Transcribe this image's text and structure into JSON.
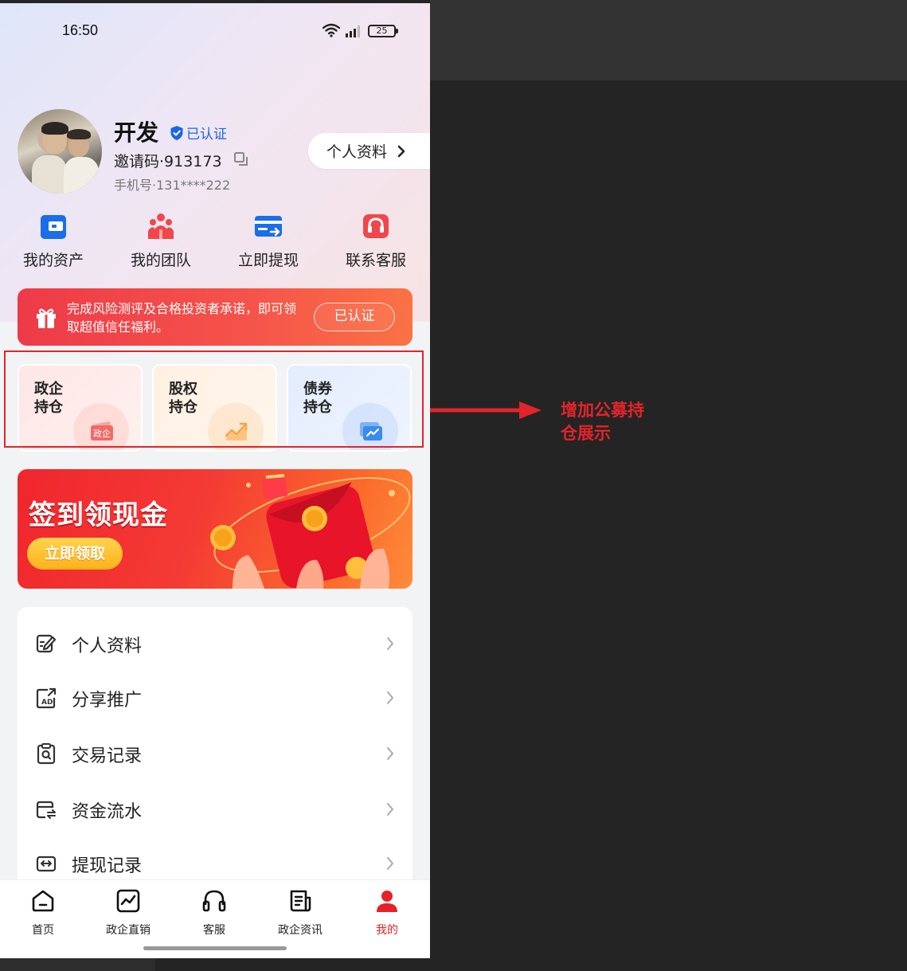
{
  "status_bar": {
    "time": "16:50",
    "battery": "25"
  },
  "profile": {
    "name": "开发",
    "verified_label": "已认证",
    "invite_code": "邀请码·913173",
    "phone": "手机号·131****222",
    "profile_button": "个人资料"
  },
  "quick_actions": [
    {
      "label": "我的资产",
      "icon": "wallet-icon"
    },
    {
      "label": "我的团队",
      "icon": "team-icon"
    },
    {
      "label": "立即提现",
      "icon": "withdraw-card-icon"
    },
    {
      "label": "联系客服",
      "icon": "headset-icon"
    }
  ],
  "risk_banner": {
    "text": "完成风险测评及合格投资者承诺，即可领取超值信任福利。",
    "button": "已认证"
  },
  "holdings": [
    {
      "title": "政企持仓",
      "icon_text": "政企",
      "icon": "gov-holding-icon"
    },
    {
      "title": "股权持仓",
      "icon": "equity-chart-icon"
    },
    {
      "title": "债券持仓",
      "icon": "bond-chart-icon"
    }
  ],
  "signin_banner": {
    "title": "签到领现金",
    "button": "立即领取"
  },
  "menu": [
    {
      "label": "个人资料",
      "icon": "edit-profile-icon"
    },
    {
      "label": "分享推广",
      "icon": "share-ad-icon"
    },
    {
      "label": "交易记录",
      "icon": "transaction-record-icon"
    },
    {
      "label": "资金流水",
      "icon": "fund-flow-icon"
    },
    {
      "label": "提现记录",
      "icon": "withdraw-record-icon"
    }
  ],
  "tabs": [
    {
      "label": "首页",
      "icon": "home-icon",
      "active": false
    },
    {
      "label": "政企直销",
      "icon": "chart-icon",
      "active": false
    },
    {
      "label": "客服",
      "icon": "headset-icon",
      "active": false
    },
    {
      "label": "政企资讯",
      "icon": "news-icon",
      "active": false
    },
    {
      "label": "我的",
      "icon": "user-icon",
      "active": true
    }
  ],
  "annotation": {
    "text": "增加公募持仓展示"
  },
  "colors": {
    "accent_red": "#e82027",
    "verified_blue": "#1a66e8",
    "annotation_red": "#e3242b"
  }
}
